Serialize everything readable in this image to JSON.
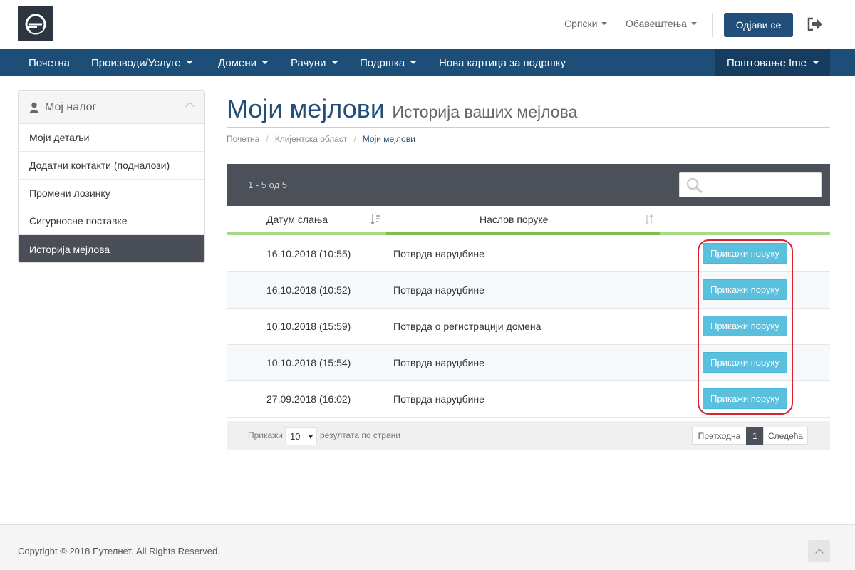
{
  "header": {
    "language": "Српски",
    "notifications": "Обавештења",
    "logout_label": "Одјави се"
  },
  "nav": {
    "items": [
      {
        "label": "Почетна",
        "dropdown": false
      },
      {
        "label": "Производи/Услуге",
        "dropdown": true
      },
      {
        "label": "Домени",
        "dropdown": true
      },
      {
        "label": "Рачуни",
        "dropdown": true
      },
      {
        "label": "Подршка",
        "dropdown": true
      },
      {
        "label": "Нова картица за подршку",
        "dropdown": false
      }
    ],
    "account": "Поштовање Ime"
  },
  "sidebar": {
    "title": "Мој налог",
    "items": [
      {
        "label": "Моји детаљи"
      },
      {
        "label": "Додатни контакти (подналози)"
      },
      {
        "label": "Промени лозинку"
      },
      {
        "label": "Сигурносне поставке"
      },
      {
        "label": "Историја мејлова",
        "active": true
      }
    ]
  },
  "page": {
    "title": "Моји мејлови",
    "subtitle": "Историја ваших мејлова"
  },
  "breadcrumb": {
    "items": [
      "Почетна",
      "Клијентска област"
    ],
    "current": "Моји мејлови"
  },
  "table": {
    "count": "1 - 5 од 5",
    "search_value": "",
    "columns": [
      "Датум слања",
      "Наслов поруке"
    ],
    "button_label": "Прикажи поруку",
    "rows": [
      {
        "date": "16.10.2018 (10:55)",
        "subject": "Потврда наруџбине"
      },
      {
        "date": "16.10.2018 (10:52)",
        "subject": "Потврда наруџбине"
      },
      {
        "date": "10.10.2018 (15:59)",
        "subject": "Потврда о регистрацији домена"
      },
      {
        "date": "10.10.2018 (15:54)",
        "subject": "Потврда наруџбине"
      },
      {
        "date": "27.09.2018 (16:02)",
        "subject": "Потврда наруџбине"
      }
    ],
    "footer": {
      "show_label": "Прикажи",
      "per_page": "10",
      "per_page_suffix": "резултата по страни",
      "prev": "Претходна",
      "page": "1",
      "next": "Следећа"
    }
  },
  "footer": {
    "copyright": "Copyright © 2018 Еутелнет. All Rights Reserved."
  },
  "colors": {
    "primary": "#1d4e78",
    "info_button": "#5bc0de",
    "sort_bar": "#7ac04a",
    "highlight": "#d9232e"
  },
  "icons": {
    "logo": "eutelnet-logo",
    "logout": "sign-out-icon",
    "search": "search-icon",
    "user": "user-icon"
  }
}
